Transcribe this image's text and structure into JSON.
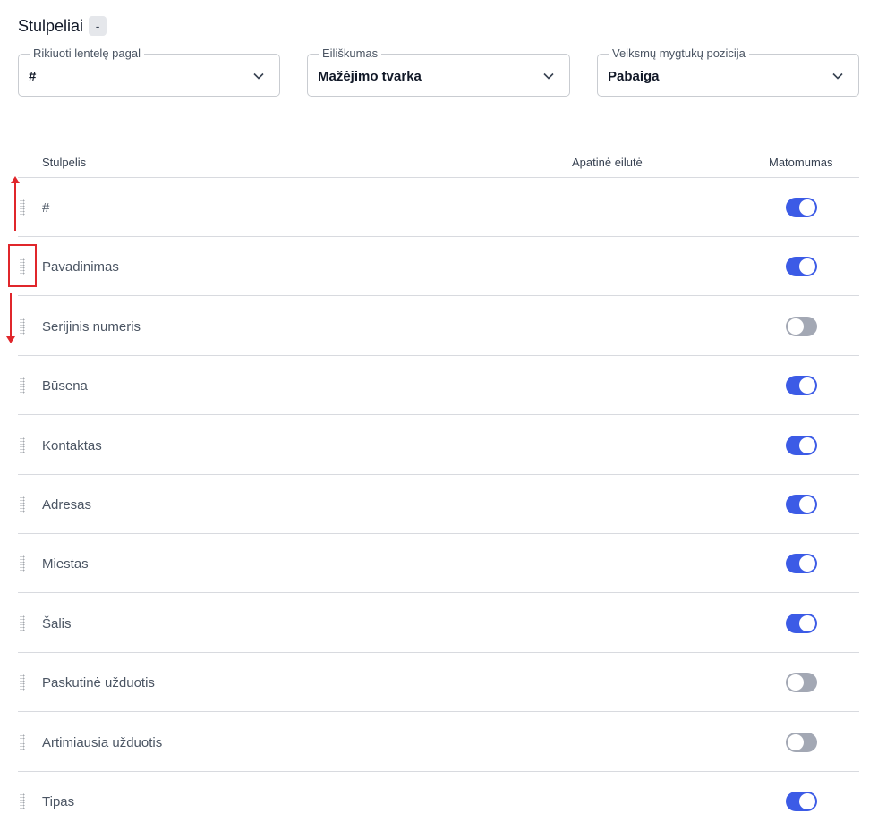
{
  "header": {
    "title": "Stulpeliai",
    "badge": "-"
  },
  "selects": [
    {
      "label": "Rikiuoti lentelę pagal",
      "value": "#"
    },
    {
      "label": "Eiliškumas",
      "value": "Mažėjimo tvarka"
    },
    {
      "label": "Veiksmų mygtukų pozicija",
      "value": "Pabaiga"
    }
  ],
  "table": {
    "headers": {
      "column": "Stulpelis",
      "bottom_row": "Apatinė eilutė",
      "visibility": "Matomumas"
    },
    "rows": [
      {
        "name": "#",
        "visible": true
      },
      {
        "name": "Pavadinimas",
        "visible": true
      },
      {
        "name": "Serijinis numeris",
        "visible": false
      },
      {
        "name": "Būsena",
        "visible": true
      },
      {
        "name": "Kontaktas",
        "visible": true
      },
      {
        "name": "Adresas",
        "visible": true
      },
      {
        "name": "Miestas",
        "visible": true
      },
      {
        "name": "Šalis",
        "visible": true
      },
      {
        "name": "Paskutinė užduotis",
        "visible": false
      },
      {
        "name": "Artimiausia užduotis",
        "visible": false
      },
      {
        "name": "Tipas",
        "visible": true
      }
    ]
  },
  "colors": {
    "toggle_on": "#3c5be6",
    "toggle_off": "#a3a8b4",
    "annotation": "#e0262b"
  }
}
